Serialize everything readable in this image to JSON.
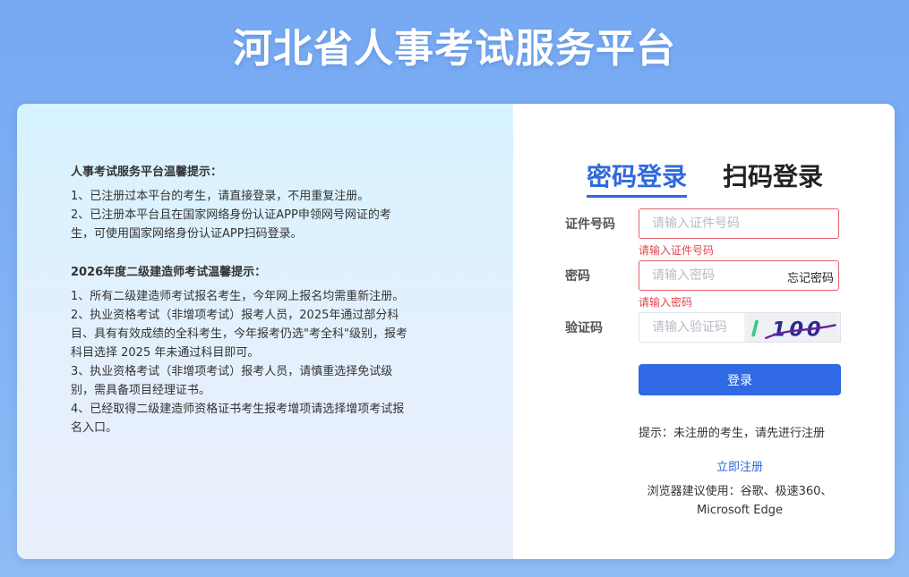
{
  "site_title": "河北省人事考试服务平台",
  "notice": {
    "heading1": "人事考试服务平台温馨提示：",
    "items1": [
      "1、已注册过本平台的考生，请直接登录，不用重复注册。",
      "2、已注册本平台且在国家网络身份认证APP申领网号网证的考生，可使用国家网络身份认证APP扫码登录。"
    ],
    "heading2": "2026年度二级建造师考试温馨提示：",
    "items2": [
      "1、所有二级建造师考试报名考生，今年网上报名均需重新注册。",
      "2、执业资格考试（非增项考试）报考人员，2025年通过部分科目、具有有效成绩的全科考生，今年报考仍选\"考全科\"级别，报考科目选择 2025 年未通过科目即可。",
      "3、执业资格考试（非增项考试）报考人员，请慎重选择免试级别，需具备项目经理证书。",
      "4、已经取得二级建造师资格证书考生报考增项请选择增项考试报名入口。"
    ]
  },
  "tabs": {
    "password_login": "密码登录",
    "qr_login": "扫码登录"
  },
  "form": {
    "id_label": "证件号码",
    "id_placeholder": "请输入证件号码",
    "id_error": "请输入证件号码",
    "pwd_label": "密码",
    "pwd_placeholder": "请输入密码",
    "pwd_error": "请输入密码",
    "forgot": "忘记密码",
    "captcha_label": "验证码",
    "captcha_placeholder": "请输入验证码",
    "captcha_text": "100",
    "login_button": "登录"
  },
  "footer": {
    "hint": "提示：未注册的考生，请先进行注册",
    "register_link": "立即注册",
    "browser_line1": "浏览器建议使用：谷歌、极速360、",
    "browser_line2": "Microsoft Edge"
  },
  "colors": {
    "accent": "#2f69dd",
    "error": "#e0464f",
    "background_top": "#76a9f3"
  }
}
